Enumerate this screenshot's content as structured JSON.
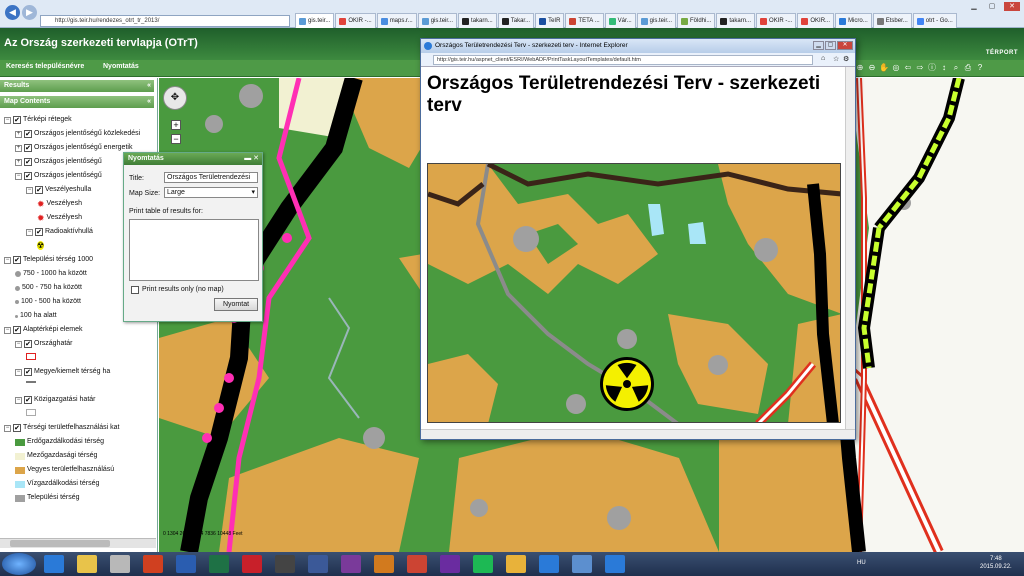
{
  "browser": {
    "address": "http://gis.teir.hu/rendezes_otrt_tr_2013/",
    "tabs": [
      "gis.teir...",
      "OKIR -...",
      "maps.r...",
      "gis.teir...",
      "takarn...",
      "Takar...",
      "TeIR",
      "TETA ...",
      "Vár...",
      "gis.teir...",
      "Földhi...",
      "takarn...",
      "OKIR -...",
      "OKIR...",
      "Micro...",
      "Etsber...",
      "otrt - Go..."
    ],
    "tab_colors": [
      "#5b9bd5",
      "#e0433b",
      "#4a8de0",
      "#5b9bd5",
      "#222",
      "#222",
      "#1a4fa0",
      "#c43",
      "#3b7",
      "#5b9bd5",
      "#7a4",
      "#222",
      "#e0433b",
      "#e0433b",
      "#2a7ad8",
      "#777",
      "#4285f4"
    ]
  },
  "app": {
    "title": "Az Ország szerkezeti tervlapja (OTrT)",
    "logo": "TÉRPORT",
    "toolbar": [
      "Keresés településnévre",
      "Nyomtatás"
    ]
  },
  "panel": {
    "results_label": "Results",
    "contents_label": "Map Contents",
    "tree": [
      {
        "label": "Térképi rétegek",
        "level": 0,
        "exp": "−",
        "cb": true
      },
      {
        "label": "Országos jelentőségű közlekedési",
        "level": 1,
        "exp": "+",
        "cb": true
      },
      {
        "label": "Országos jelentőségű energetik",
        "level": 1,
        "exp": "+",
        "cb": true
      },
      {
        "label": "Országos jelentőségű",
        "level": 1,
        "exp": "+",
        "cb": true
      },
      {
        "label": "Országos jelentőségű",
        "level": 1,
        "exp": "−",
        "cb": true
      },
      {
        "label": "Veszélyeshulla",
        "level": 2,
        "exp": "−",
        "cb": true
      },
      {
        "label": "Veszélyesh",
        "level": 3,
        "icon": "star"
      },
      {
        "label": "Veszélyesh",
        "level": 3,
        "icon": "star"
      },
      {
        "label": "Radioaktívhullá",
        "level": 2,
        "exp": "−",
        "cb": true
      },
      {
        "label": "",
        "level": 3,
        "icon": "radiation"
      },
      {
        "label": "Települési térség 1000",
        "level": 0,
        "exp": "−",
        "cb": true
      },
      {
        "label": "750 - 1000 ha között",
        "level": 1,
        "icon": "dot4"
      },
      {
        "label": "500 - 750 ha között",
        "level": 1,
        "icon": "dot3"
      },
      {
        "label": "100 - 500 ha között",
        "level": 1,
        "icon": "dot2"
      },
      {
        "label": "100 ha alatt",
        "level": 1,
        "icon": "dot1"
      },
      {
        "label": "Alaptérképi elemek",
        "level": 0,
        "exp": "−",
        "cb": true
      },
      {
        "label": "Országhatár",
        "level": 1,
        "exp": "−",
        "cb": true
      },
      {
        "label": "",
        "level": 2,
        "icon": "redbox"
      },
      {
        "label": "Megye/kiemelt térség ha",
        "level": 1,
        "exp": "−",
        "cb": true
      },
      {
        "label": "",
        "level": 2,
        "icon": "line"
      },
      {
        "label": "Közigazgatási határ",
        "level": 1,
        "exp": "−",
        "cb": true
      },
      {
        "label": "",
        "level": 2,
        "icon": "greybox"
      },
      {
        "label": "Térségi területfelhasználási kat",
        "level": 0,
        "exp": "−",
        "cb": true
      },
      {
        "label": "Erdőgazdálkodási térség",
        "level": 1,
        "icon": "sw-forest"
      },
      {
        "label": "Mezőgazdasági térség",
        "level": 1,
        "icon": "sw-agri"
      },
      {
        "label": "Vegyes területfelhasználású",
        "level": 1,
        "icon": "sw-mixed"
      },
      {
        "label": "Vízgazdálkodási térség",
        "level": 1,
        "icon": "sw-water"
      },
      {
        "label": "Települési térség",
        "level": 1,
        "icon": "sw-urban"
      }
    ]
  },
  "print_dialog": {
    "title": "Nyomtatás",
    "title_label": "Title:",
    "title_value": "Országos Területrendezési",
    "size_label": "Map Size:",
    "size_value": "Large",
    "table_label": "Print table of results for:",
    "only_label": "Print results only (no map)",
    "button": "Nyomtat"
  },
  "popup": {
    "window_title": "Országos Területrendezési Terv - szerkezeti terv - Internet Explorer",
    "url": "http://gis.teir.hu/aspnet_client/ESRI/WebADF/PrintTaskLayoutTemplates/default.htm",
    "heading": "Országos Területrendezési Terv - szerkezeti terv"
  },
  "scalebar": "0   1304 2612   5224   7836   10448 Feet",
  "taskbar": {
    "lang": "HU",
    "time": "7:48",
    "date": "2015.09.22."
  },
  "colors": {
    "forest": "#4a9a3f",
    "agri": "#f2f1d2",
    "mixed": "#dca54a",
    "water": "#a9e6f7",
    "urban": "#a0a0a0",
    "road": "#000000",
    "border": "#ff2fb4",
    "rail": "#e0301e"
  }
}
